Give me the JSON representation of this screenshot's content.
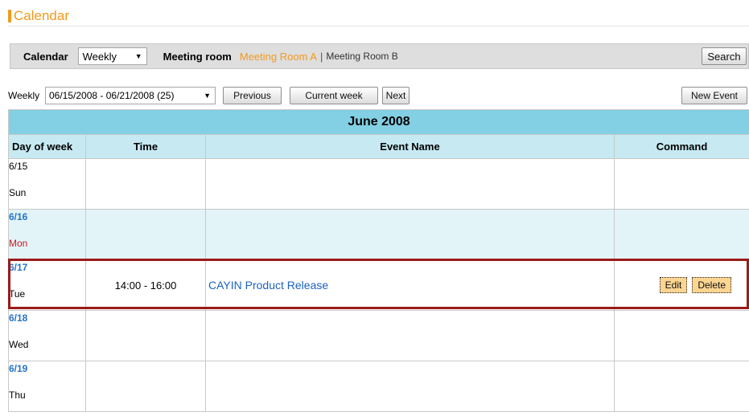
{
  "header": {
    "title": "Calendar"
  },
  "filter": {
    "calendar_label": "Calendar",
    "view": "Weekly",
    "room_label": "Meeting room",
    "rooms": [
      "Meeting Room A",
      "Meeting Room B"
    ],
    "separator": "|",
    "search_label": "Search"
  },
  "toolbar": {
    "weekly_label": "Weekly",
    "week_range": "06/15/2008 - 06/21/2008 (25)",
    "previous_label": "Previous",
    "current_week_label": "Current week",
    "next_label": "Next",
    "new_event_label": "New Event"
  },
  "table": {
    "month": "June 2008",
    "columns": [
      "Day of week",
      "Time",
      "Event Name",
      "Command"
    ],
    "days": [
      {
        "date": "6/15",
        "day": "Sun",
        "time": "",
        "event": ""
      },
      {
        "date": "6/16",
        "day": "Mon",
        "time": "",
        "event": ""
      },
      {
        "date": "6/17",
        "day": "Tue",
        "time": "14:00 - 16:00",
        "event": "CAYIN Product Release",
        "edit": "Edit",
        "delete": "Delete"
      },
      {
        "date": "6/18",
        "day": "Wed",
        "time": "",
        "event": ""
      },
      {
        "date": "6/19",
        "day": "Thu",
        "time": "",
        "event": ""
      }
    ]
  },
  "colors": {
    "accent": "#f29a1e",
    "month_header": "#83cfe3",
    "column_header": "#c6e9f2",
    "today_row": "#e2f4f8",
    "highlight": "#9b1a1a"
  }
}
